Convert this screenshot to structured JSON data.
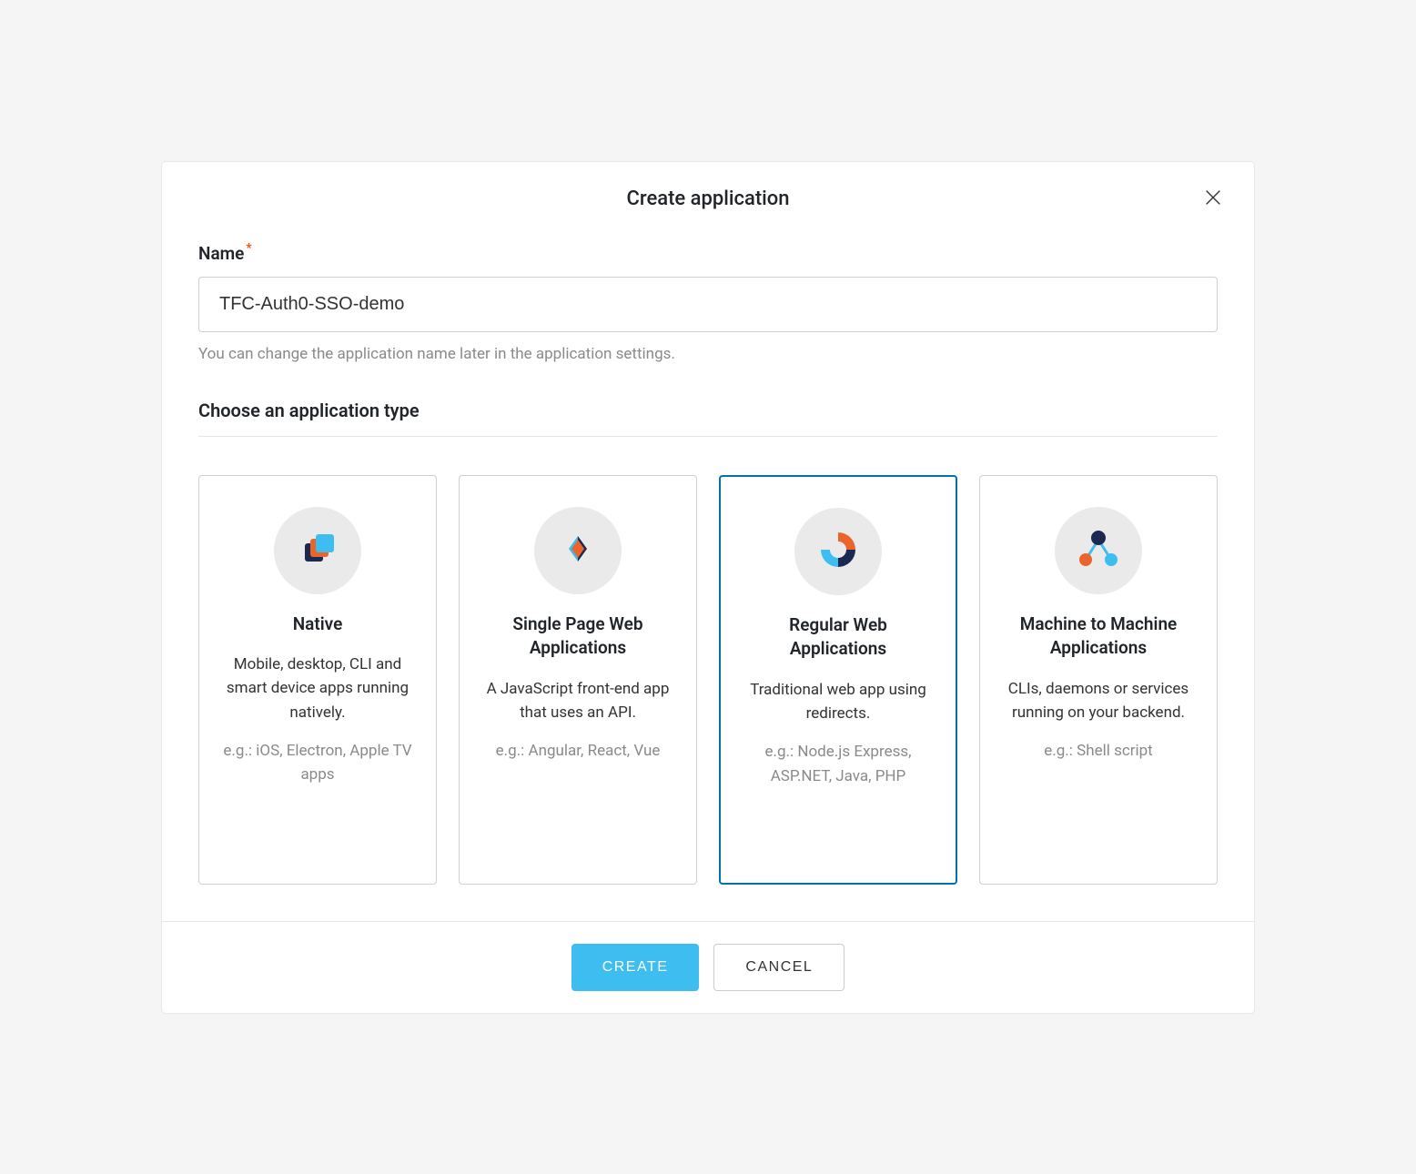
{
  "modal": {
    "title": "Create application",
    "nameField": {
      "label": "Name",
      "value": "TFC-Auth0-SSO-demo",
      "helpText": "You can change the application name later in the application settings."
    },
    "typeSection": {
      "title": "Choose an application type"
    },
    "types": [
      {
        "title": "Native",
        "desc": "Mobile, desktop, CLI and smart device apps running natively.",
        "example": "e.g.: iOS, Electron, Apple TV apps"
      },
      {
        "title": "Single Page Web Applications",
        "desc": "A JavaScript front-end app that uses an API.",
        "example": "e.g.: Angular, React, Vue"
      },
      {
        "title": "Regular Web Applications",
        "desc": "Traditional web app using redirects.",
        "example": "e.g.: Node.js Express, ASP.NET, Java, PHP"
      },
      {
        "title": "Machine to Machine Applications",
        "desc": "CLIs, daemons or services running on your backend.",
        "example": "e.g.: Shell script"
      }
    ],
    "buttons": {
      "create": "CREATE",
      "cancel": "CANCEL"
    }
  }
}
